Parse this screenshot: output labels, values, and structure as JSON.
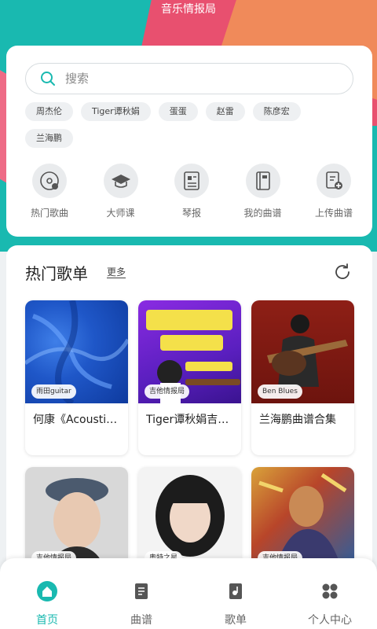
{
  "app": {
    "title": "音乐情报局"
  },
  "colors": {
    "accent": "#19b9b0",
    "pink": "#e8506f"
  },
  "search": {
    "placeholder": "搜索",
    "icon": "search-icon"
  },
  "hot_tags": [
    "周杰伦",
    "Tiger谭秋娟",
    "蛋蛋",
    "赵雷",
    "陈彦宏",
    "兰海鹏"
  ],
  "quick_links": [
    {
      "label": "热门歌曲",
      "icon": "disc-icon"
    },
    {
      "label": "大师课",
      "icon": "graduation-cap-icon"
    },
    {
      "label": "琴报",
      "icon": "news-icon"
    },
    {
      "label": "我的曲谱",
      "icon": "book-icon"
    },
    {
      "label": "上传曲谱",
      "icon": "upload-score-icon"
    }
  ],
  "playlists": {
    "title": "热门歌单",
    "more": "更多",
    "items": [
      {
        "badge": "雨田guitar",
        "title": "何康《Acoustic Painting》专…"
      },
      {
        "badge": "吉他情报局",
        "title": "Tiger谭秋娟吉他教学合集配套…"
      },
      {
        "badge": "Ben Blues",
        "title": "兰海鹏曲谱合集"
      },
      {
        "badge": "吉他情报局",
        "title": ""
      },
      {
        "badge": "奥特之星",
        "title": ""
      },
      {
        "badge": "吉他情报局",
        "title": ""
      }
    ]
  },
  "nav": [
    {
      "label": "首页",
      "icon": "home-icon",
      "active": true
    },
    {
      "label": "曲谱",
      "icon": "score-icon",
      "active": false
    },
    {
      "label": "歌单",
      "icon": "playlist-icon",
      "active": false
    },
    {
      "label": "个人中心",
      "icon": "profile-icon",
      "active": false
    }
  ]
}
